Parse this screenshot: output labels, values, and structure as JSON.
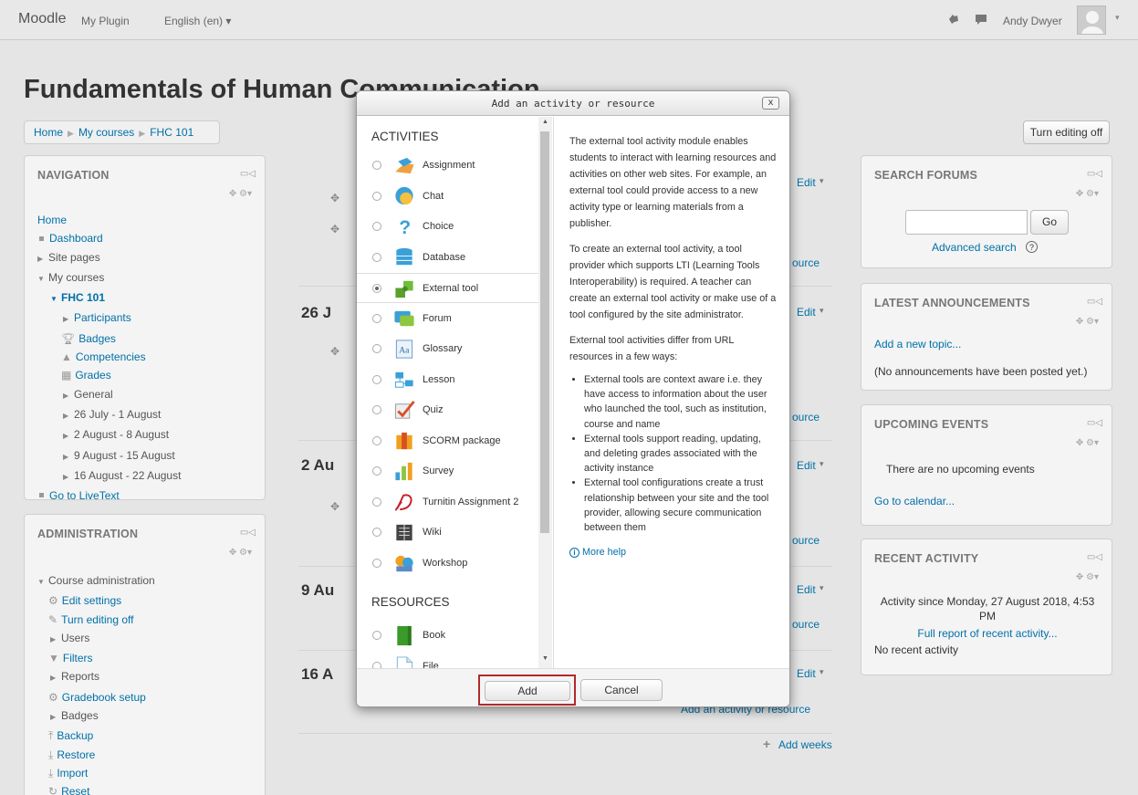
{
  "topbar": {
    "brand": "Moodle",
    "links": [
      "My Plugin",
      "English (en) ▾"
    ],
    "user_name": "Andy Dwyer",
    "icons": [
      "notification-icon",
      "message-icon",
      "avatar",
      "user-menu-chevron-icon"
    ]
  },
  "page": {
    "title": "Fundamentals of Human Communication",
    "breadcrumbs": [
      "Home",
      "My courses",
      "FHC 101"
    ],
    "turn_editing_off_label": "Turn editing off"
  },
  "navigation": {
    "heading": "NAVIGATION",
    "items": {
      "home": "Home",
      "dashboard": "Dashboard",
      "site_pages": "Site pages",
      "my_courses": "My courses",
      "course": "FHC 101",
      "participants": "Participants",
      "badges": "Badges",
      "competencies": "Competencies",
      "grades": "Grades",
      "general": "General",
      "w1": "26 July - 1 August",
      "w2": "2 August - 8 August",
      "w3": "9 August - 15 August",
      "w4": "16 August - 22 August",
      "livetext": "Go to LiveText"
    }
  },
  "administration": {
    "heading": "ADMINISTRATION",
    "items": {
      "course_admin": "Course administration",
      "edit_settings": "Edit settings",
      "turn_editing_off": "Turn editing off",
      "users": "Users",
      "filters": "Filters",
      "reports": "Reports",
      "gradebook": "Gradebook setup",
      "badges": "Badges",
      "backup": "Backup",
      "restore": "Restore",
      "import": "Import",
      "reset": "Reset"
    }
  },
  "center": {
    "sections": [
      "26 J",
      "2 Au",
      "9 Au",
      "16 A"
    ],
    "edit_label": "Edit",
    "add_activity_label": "Add an activity or resource",
    "add_activity_partial": "ource",
    "add_weeks_label": "Add weeks"
  },
  "search_forums": {
    "heading": "SEARCH FORUMS",
    "go_label": "Go",
    "advanced_label": "Advanced search"
  },
  "latest_announcements": {
    "heading": "LATEST ANNOUNCEMENTS",
    "add_topic": "Add a new topic...",
    "empty_text": "(No announcements have been posted yet.)"
  },
  "upcoming_events": {
    "heading": "UPCOMING EVENTS",
    "empty_text": "There are no upcoming events",
    "calendar_link": "Go to calendar..."
  },
  "recent_activity": {
    "heading": "RECENT ACTIVITY",
    "since_text": "Activity since Monday, 27 August 2018, 4:53 PM",
    "full_report": "Full report of recent activity...",
    "empty_text": "No recent activity"
  },
  "modal": {
    "title": "Add an activity or resource",
    "close_label": "x",
    "activities_heading": "ACTIVITIES",
    "resources_heading": "RESOURCES",
    "activities": [
      {
        "label": "Assignment",
        "icon": "assignment-icon",
        "selected": false
      },
      {
        "label": "Chat",
        "icon": "chat-icon",
        "selected": false
      },
      {
        "label": "Choice",
        "icon": "choice-icon",
        "selected": false
      },
      {
        "label": "Database",
        "icon": "database-icon",
        "selected": false
      },
      {
        "label": "External tool",
        "icon": "external-tool-icon",
        "selected": true
      },
      {
        "label": "Forum",
        "icon": "forum-icon",
        "selected": false
      },
      {
        "label": "Glossary",
        "icon": "glossary-icon",
        "selected": false
      },
      {
        "label": "Lesson",
        "icon": "lesson-icon",
        "selected": false
      },
      {
        "label": "Quiz",
        "icon": "quiz-icon",
        "selected": false
      },
      {
        "label": "SCORM package",
        "icon": "scorm-icon",
        "selected": false
      },
      {
        "label": "Survey",
        "icon": "survey-icon",
        "selected": false
      },
      {
        "label": "Turnitin Assignment 2",
        "icon": "turnitin-icon",
        "selected": false
      },
      {
        "label": "Wiki",
        "icon": "wiki-icon",
        "selected": false
      },
      {
        "label": "Workshop",
        "icon": "workshop-icon",
        "selected": false
      }
    ],
    "resources": [
      {
        "label": "Book",
        "icon": "book-icon",
        "selected": false
      },
      {
        "label": "File",
        "icon": "file-icon",
        "selected": false
      }
    ],
    "description": {
      "p1": "The external tool activity module enables students to interact with learning resources and activities on other web sites. For example, an external tool could provide access to a new activity type or learning materials from a publisher.",
      "p2": "To create an external tool activity, a tool provider which supports LTI (Learning Tools Interoperability) is required. A teacher can create an external tool activity or make use of a tool configured by the site administrator.",
      "p3": "External tool activities differ from URL resources in a few ways:",
      "bullets": [
        "External tools are context aware i.e. they have access to information about the user who launched the tool, such as institution, course and name",
        "External tools support reading, updating, and deleting grades associated with the activity instance",
        "External tool configurations create a trust relationship between your site and the tool provider, allowing secure communication between them"
      ],
      "more_help": "More help"
    },
    "add_label": "Add",
    "cancel_label": "Cancel"
  }
}
